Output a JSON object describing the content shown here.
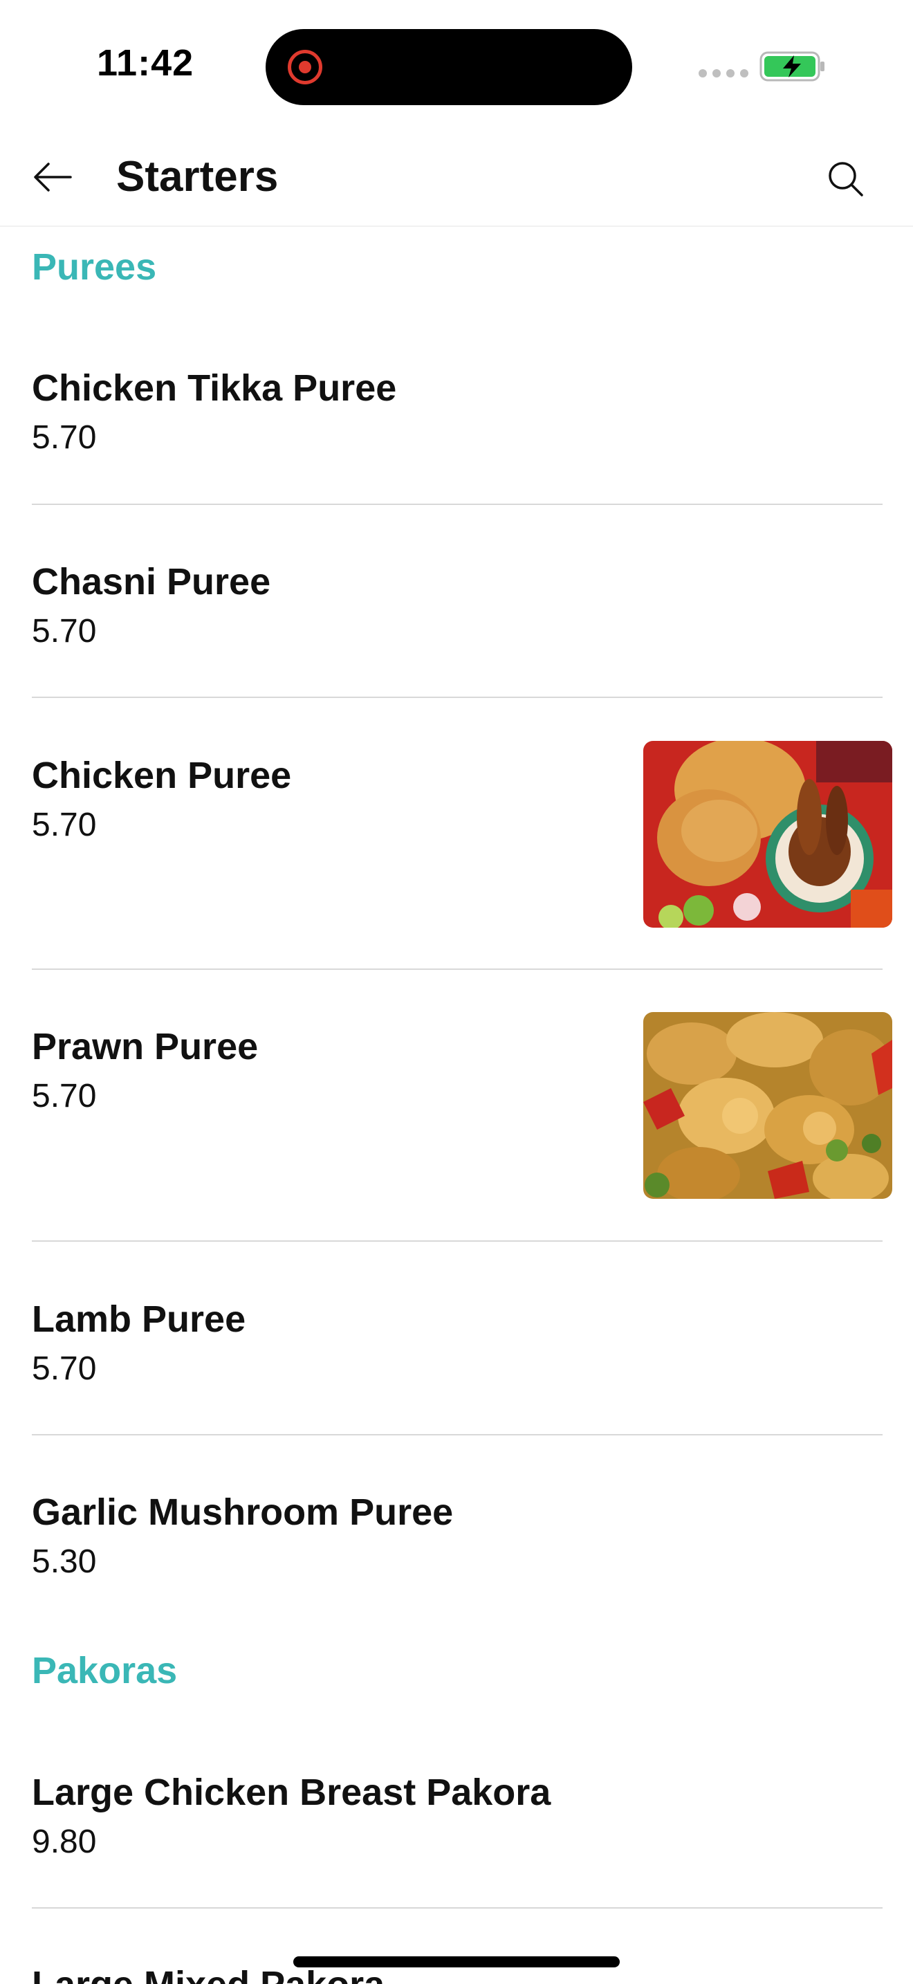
{
  "status_bar": {
    "time": "11:42",
    "battery_color": "#34c759"
  },
  "header": {
    "title": "Starters",
    "back_icon": "arrow-left-icon",
    "search_icon": "search-icon"
  },
  "accent_color": "#3ab7b6",
  "sections": [
    {
      "title": "Purees",
      "items": [
        {
          "name": "Chicken Tikka Puree",
          "price": "5.70"
        },
        {
          "name": "Chasni Puree",
          "price": "5.70"
        },
        {
          "name": "Chicken Puree",
          "price": "5.70",
          "image": "chicken-puree-photo"
        },
        {
          "name": "Prawn Puree",
          "price": "5.70",
          "image": "prawn-puree-photo"
        },
        {
          "name": "Lamb Puree",
          "price": "5.70"
        },
        {
          "name": "Garlic Mushroom Puree",
          "price": "5.30"
        }
      ]
    },
    {
      "title": "Pakoras",
      "items": [
        {
          "name": "Large Chicken Breast Pakora",
          "price": "9.80"
        },
        {
          "name": "Large Mixed Pakora",
          "price": ""
        }
      ]
    }
  ]
}
